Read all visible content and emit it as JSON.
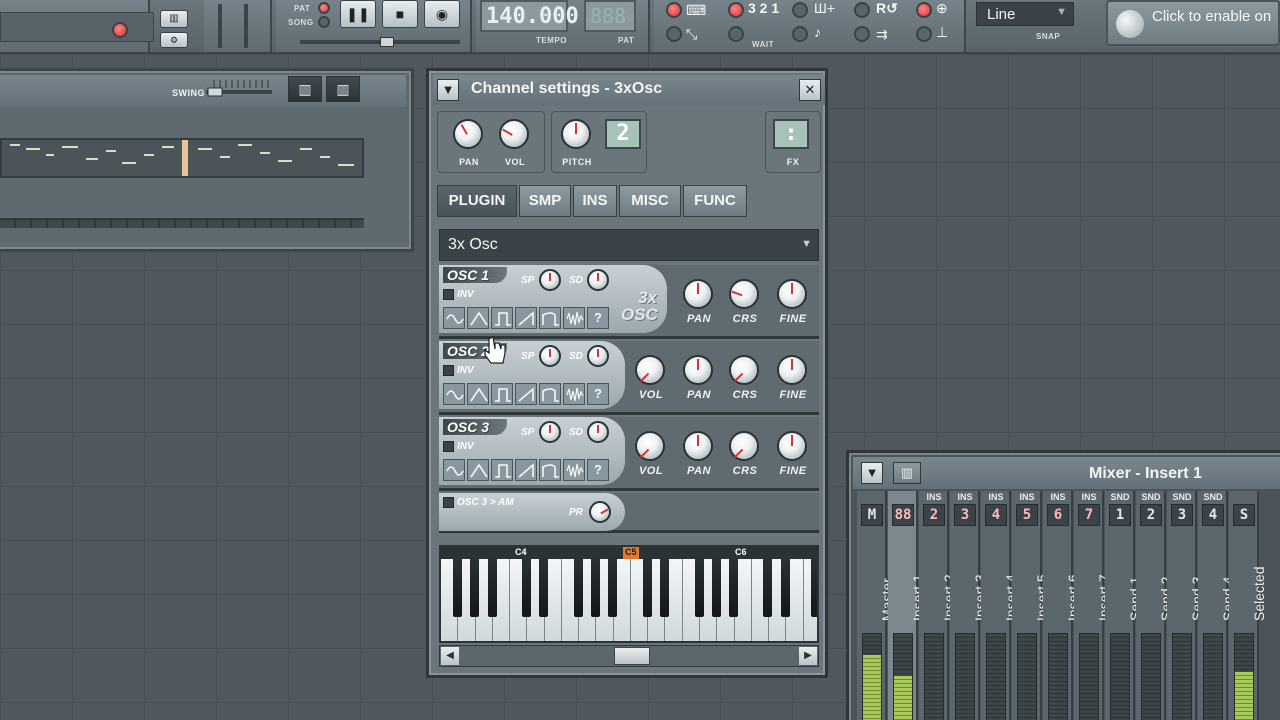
{
  "toolbar": {
    "pat_label": "PAT",
    "song_label": "SONG",
    "tempo_value": "140.000",
    "tempo_label": "TEMPO",
    "pattern_value": "888",
    "pattern_label": "PAT",
    "snap_label": "SNAP",
    "snap_value": "Line",
    "hint_text": "Click to enable on",
    "wait_label": "WAIT",
    "count_label": "3 2 1"
  },
  "step_seq": {
    "swing_label": "SWING"
  },
  "channel_settings": {
    "title": "Channel settings - 3xOsc",
    "close_label": "✕",
    "pan_label": "PAN",
    "vol_label": "VOL",
    "pitch_label": "PITCH",
    "pitch_range": "2",
    "fx_label": "FX",
    "fx_value": ":",
    "tabs": [
      "PLUGIN",
      "SMP",
      "INS",
      "MISC",
      "FUNC"
    ],
    "plugin_name": "3x Osc",
    "osc": [
      {
        "title": "OSC 1",
        "inv": "INV",
        "sp": "SP",
        "sd": "SD"
      },
      {
        "title": "OSC 2",
        "inv": "INV",
        "sp": "SP",
        "sd": "SD"
      },
      {
        "title": "OSC 3",
        "inv": "INV",
        "sp": "SP",
        "sd": "SD"
      }
    ],
    "osc_knob_labels": {
      "vol": "VOL",
      "pan": "PAN",
      "crs": "CRS",
      "fine": "FINE"
    },
    "logo_line1": "3x",
    "logo_line2": "OSC",
    "am_label": "OSC 3 > AM",
    "pr_label": "PR",
    "wave_unknown": "?",
    "keyboard_markers": [
      "C4",
      "C5",
      "C6"
    ]
  },
  "mixer": {
    "title": "Mixer - Insert 1",
    "master_tag": "M",
    "selected_tag": "S",
    "strips": [
      {
        "name": "Master",
        "tag": "",
        "num": "",
        "level": 0.78
      },
      {
        "name": "Insert 1",
        "tag": "",
        "num": "88",
        "level": 0.55
      },
      {
        "name": "Insert 2",
        "tag": "INS",
        "num": "2",
        "level": 0.0
      },
      {
        "name": "Insert 3",
        "tag": "INS",
        "num": "3",
        "level": 0.0
      },
      {
        "name": "Insert 4",
        "tag": "INS",
        "num": "4",
        "level": 0.0
      },
      {
        "name": "Insert 5",
        "tag": "INS",
        "num": "5",
        "level": 0.0
      },
      {
        "name": "Insert 6",
        "tag": "INS",
        "num": "6",
        "level": 0.0
      },
      {
        "name": "Insert 7",
        "tag": "INS",
        "num": "7",
        "level": 0.0
      },
      {
        "name": "Send 1",
        "tag": "SND",
        "num": "1",
        "level": 0.0
      },
      {
        "name": "Send 2",
        "tag": "SND",
        "num": "2",
        "level": 0.0
      },
      {
        "name": "Send 3",
        "tag": "SND",
        "num": "3",
        "level": 0.0
      },
      {
        "name": "Send 4",
        "tag": "SND",
        "num": "4",
        "level": 0.0
      },
      {
        "name": "Selected",
        "tag": "",
        "num": "",
        "level": 0.6
      }
    ]
  }
}
